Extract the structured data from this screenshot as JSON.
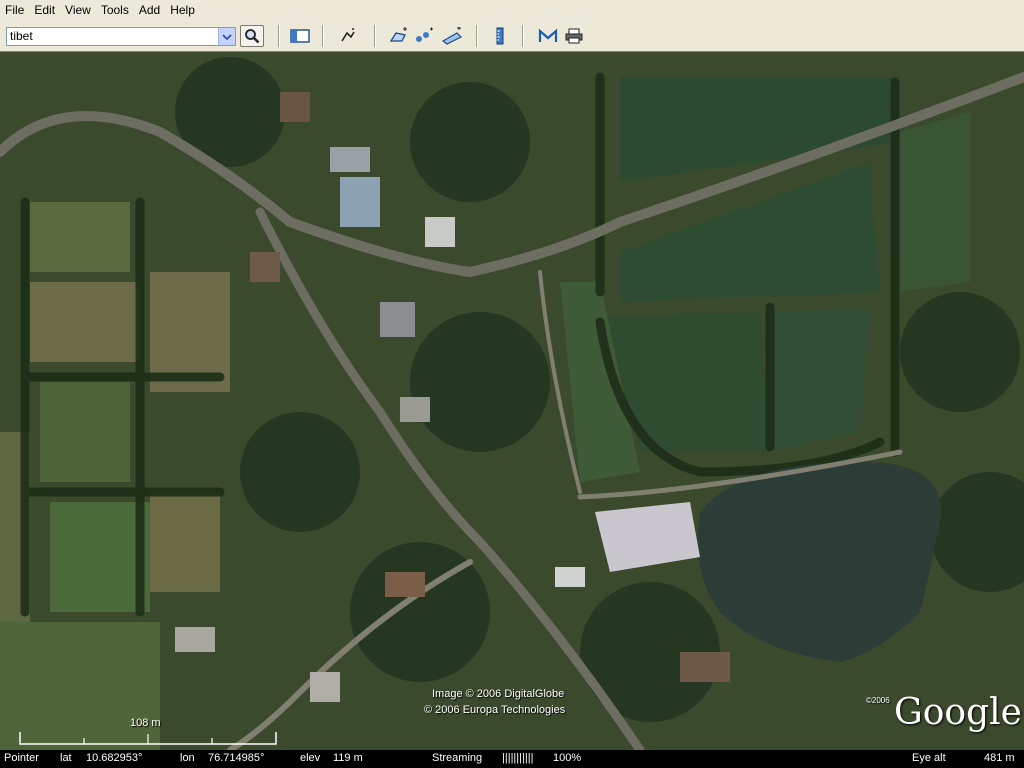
{
  "menu": [
    "File",
    "Edit",
    "View",
    "Tools",
    "Add",
    "Help"
  ],
  "search": {
    "value": "tibet"
  },
  "toolbar_icons": [
    "search-icon",
    "sidebar-toggle-icon",
    "placemark-icon",
    "polygon-icon",
    "path-icon",
    "image-overlay-icon",
    "ruler-icon",
    "email-icon",
    "print-icon"
  ],
  "map": {
    "attribution_image": "Image © 2006 DigitalGlobe",
    "attribution_copyright": "© 2006 Europa Technologies",
    "logo_copyright": "©2006",
    "logo_text": "Google",
    "scale_label": "108 m"
  },
  "status": {
    "pointer_label": "Pointer",
    "lat_label": "lat",
    "lat_value": "10.682953°",
    "lon_label": "lon",
    "lon_value": "76.714985°",
    "elev_label": "elev",
    "elev_value": "119 m",
    "streaming_label": "Streaming",
    "streaming_bar": "|||||||||||",
    "streaming_percent": "100%",
    "eye_alt_label": "Eye alt",
    "eye_alt_value": "481 m"
  },
  "colors": {
    "chrome": "#ece9d8",
    "status_bg": "#000000"
  }
}
